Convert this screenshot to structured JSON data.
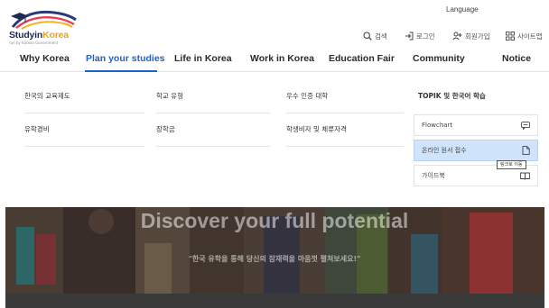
{
  "logo": {
    "name_main": "Studyin",
    "name_accent": "Korea",
    "tagline": "run by Korean Government"
  },
  "header": {
    "language": "Language",
    "search": "검색",
    "login": "로그인",
    "signup": "회원가입",
    "sitemap": "사이트맵"
  },
  "nav": {
    "items": [
      {
        "label": "Why Korea"
      },
      {
        "label": "Plan your studies",
        "active": true
      },
      {
        "label": "Life in Korea"
      },
      {
        "label": "Work in Korea"
      },
      {
        "label": "Education Fair"
      },
      {
        "label": "Community"
      },
      {
        "label": "Notice"
      }
    ]
  },
  "dropdown": {
    "col1": [
      "한국의 교육제도",
      "유학경비"
    ],
    "col2": [
      "학교 유형",
      "장학금"
    ],
    "col3": [
      "우수 인증 대학",
      "학생비자 및 체류자격"
    ],
    "col4": {
      "title": "TOPIK 및 한국어 학습",
      "cards": [
        {
          "label": "Flowchart",
          "icon": "chat-icon"
        },
        {
          "label": "온라인 원서 접수",
          "icon": "document-icon",
          "highlighted": true
        },
        {
          "label": "가이드북",
          "icon": "book-icon"
        }
      ]
    },
    "tooltip": "링크로 이동"
  },
  "hero": {
    "title": "Discover your full potential",
    "subtitle": "\"한국 유학을 통해 당신의 잠재력을 마음껏 펼쳐보세요!\""
  },
  "colors": {
    "accent": "#1f62c9",
    "brand_navy": "#1c2a55",
    "brand_yellow": "#e9a21b",
    "highlight_card": "#cfe3fb"
  }
}
